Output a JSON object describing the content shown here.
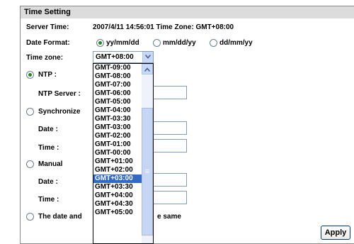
{
  "section_title": "Time Setting",
  "server_time": {
    "label": "Server Time:",
    "value": "2007/4/11 14:56:01 Time Zone: GMT+08:00"
  },
  "date_format": {
    "label": "Date Format:",
    "options": [
      "yy/mm/dd",
      "mm/dd/yy",
      "dd/mm/yy"
    ],
    "selected": "yy/mm/dd"
  },
  "time_zone": {
    "label": "Time zone:",
    "value": "GMT+08:00",
    "options": [
      "GMT-09:00",
      "GMT-08:00",
      "GMT-07:00",
      "GMT-06:00",
      "GMT-05:00",
      "GMT-04:00",
      "GMT-03:30",
      "GMT-03:00",
      "GMT-02:00",
      "GMT-01:00",
      "GMT-00:00",
      "GMT+01:00",
      "GMT+02:00",
      "GMT+03:00",
      "GMT+03:30",
      "GMT+04:00",
      "GMT+04:30",
      "GMT+05:00"
    ],
    "highlighted": "GMT+03:00"
  },
  "ntp": {
    "label": "NTP :",
    "server_label": "NTP Server :",
    "server_value": ""
  },
  "synchronize": {
    "label": "Synchronize",
    "date_label": "Date :",
    "time_label": "Time :",
    "date_value": "",
    "time_value": ""
  },
  "manual": {
    "label": "Manual",
    "date_label": "Date :",
    "time_label": "Time :",
    "date_value": "",
    "time_value": ""
  },
  "keep": {
    "label_left": "The date and",
    "label_right": "e same"
  },
  "apply_label": "Apply",
  "icons": {
    "select_arrow": "chevron-down-icon",
    "scroll_up": "chevron-up-icon"
  },
  "colors": {
    "selection": "#316ac5",
    "radio_dot": "#1e8a1e"
  }
}
